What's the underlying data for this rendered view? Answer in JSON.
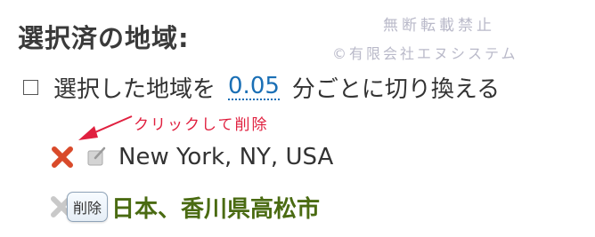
{
  "heading": "選択済の地域:",
  "watermark": {
    "line1": "無断転載禁止",
    "line2": "©有限会社エヌシステム"
  },
  "toggle": {
    "label_before": "選択した地域を",
    "interval": "0.05",
    "label_after": "分ごとに切り換える"
  },
  "annotation": "クリックして削除",
  "regions": [
    {
      "name": "New York, NY, USA"
    },
    {
      "name": "日本、香川県高松市"
    }
  ],
  "tooltip": "削除",
  "colors": {
    "remove_icon": "#d94a2a",
    "link": "#1a6fb5",
    "annotation": "#e0203f",
    "selected_region": "#4a6b12"
  }
}
